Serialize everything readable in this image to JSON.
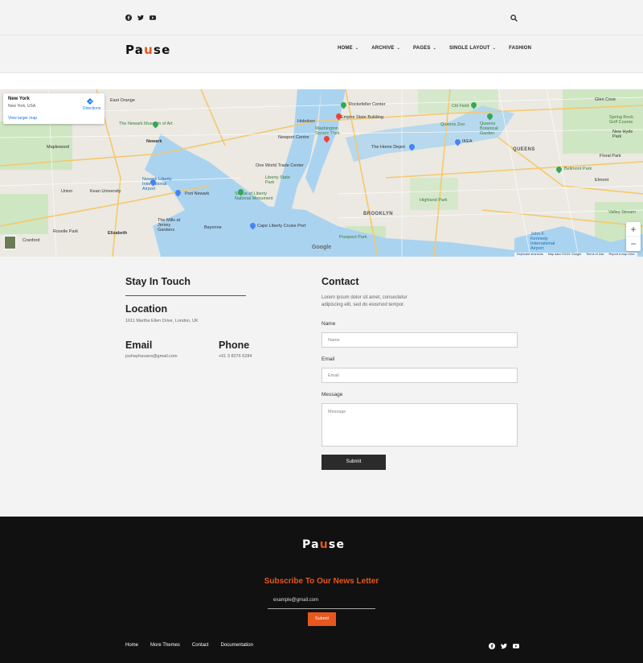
{
  "topbar": {
    "social_icons": [
      "facebook-icon",
      "twitter-icon",
      "youtube-icon"
    ],
    "search_icon": "search-icon"
  },
  "header": {
    "logo": {
      "before": "Pa",
      "accent": "u",
      "after": "se"
    },
    "nav": [
      {
        "label": "HOME",
        "has_dropdown": true
      },
      {
        "label": "ARCHIVE",
        "has_dropdown": true
      },
      {
        "label": "PAGES",
        "has_dropdown": true
      },
      {
        "label": "SINGLE LAYOUT",
        "has_dropdown": true
      },
      {
        "label": "FASHION",
        "has_dropdown": false
      }
    ]
  },
  "map": {
    "card": {
      "title": "New York",
      "address": "New York, USA",
      "directions": "Directions",
      "view_larger": "View larger map"
    },
    "labels": {
      "east_orange": "East Orange",
      "newark": "Newark",
      "the_newark_museum": "The Newark Museum of Art",
      "maplewood": "Maplewood",
      "union": "Union",
      "kean_university": "Kean University",
      "elizabeth": "Elizabeth",
      "roselle_park": "Roselle Park",
      "cranford": "Cranford",
      "newark_airport": "Newark Liberty International Airport",
      "port_newark": "Port Newark",
      "the_mills": "The Mills at Jersey Gardens",
      "bayonne": "Bayonne",
      "liberty_state_park": "Liberty State Park",
      "statue_of_liberty": "Statue of Liberty National Monument",
      "one_world": "One World Trade Center",
      "newport_centre": "Newport Centre",
      "hoboken": "Hoboken",
      "rockefeller": "Rockefeller Center",
      "empire_state": "Empire State Building",
      "washington_square": "Washington Square Park",
      "the_home_depot": "The Home Depot",
      "cape_liberty": "Cape Liberty Cruise Port",
      "brooklyn": "BROOKLYN",
      "highland_park": "Highland Park",
      "prospect_park": "Prospect Park",
      "queens": "QUEENS",
      "queens_zoo": "Queens Zoo",
      "queens_botanical": "Queens Botanical Garden",
      "ikea": "IKEA",
      "citi_field": "Citi Field",
      "bellmont_park": "Bellmont Park",
      "jfk": "John F. Kennedy International Airport",
      "valley_stream": "Valley Stream",
      "floral_park": "Floral Park",
      "new_hyde_park": "New Hyde Park",
      "spring_rock": "Spring Rock Golf Course",
      "elmont": "Elmont",
      "glen_cove": "Glen Cove"
    },
    "google": "Google",
    "attribution": [
      "Keyboard shortcuts",
      "Map data ©2021 Google",
      "Terms of Use",
      "Report a map error"
    ]
  },
  "contact_info": {
    "heading": "Stay In Touch",
    "location_heading": "Location",
    "location_value": "1611 Martha Ellen Drive, London, UK",
    "email_heading": "Email",
    "email_value": "joshephavans@gmail.com",
    "phone_heading": "Phone",
    "phone_value": "+61 3 8376 6284"
  },
  "contact_form": {
    "heading": "Contact",
    "intro": "Lorem ipsum dolor sit amet, consectetur adipiscing elit, sed do eiusmod tempor.",
    "name_label": "Name",
    "name_placeholder": "Name",
    "email_label": "Email",
    "email_placeholder": "Email",
    "message_label": "Message",
    "message_placeholder": "Message",
    "submit": "Submit"
  },
  "footer": {
    "logo": {
      "before": "Pa",
      "accent": "u",
      "after": "se"
    },
    "subscribe_title": "Subscribe To Our News Letter",
    "subscribe_placeholder": "example@gmail.com",
    "subscribe_button": "Submit",
    "links": [
      "Home",
      "More Themes",
      "Contact",
      "Documentation"
    ],
    "social_icons": [
      "facebook-icon",
      "twitter-icon",
      "youtube-icon"
    ]
  },
  "colors": {
    "accent": "#e8571e",
    "dark": "#111111",
    "light_bg": "#f3f3f3"
  }
}
